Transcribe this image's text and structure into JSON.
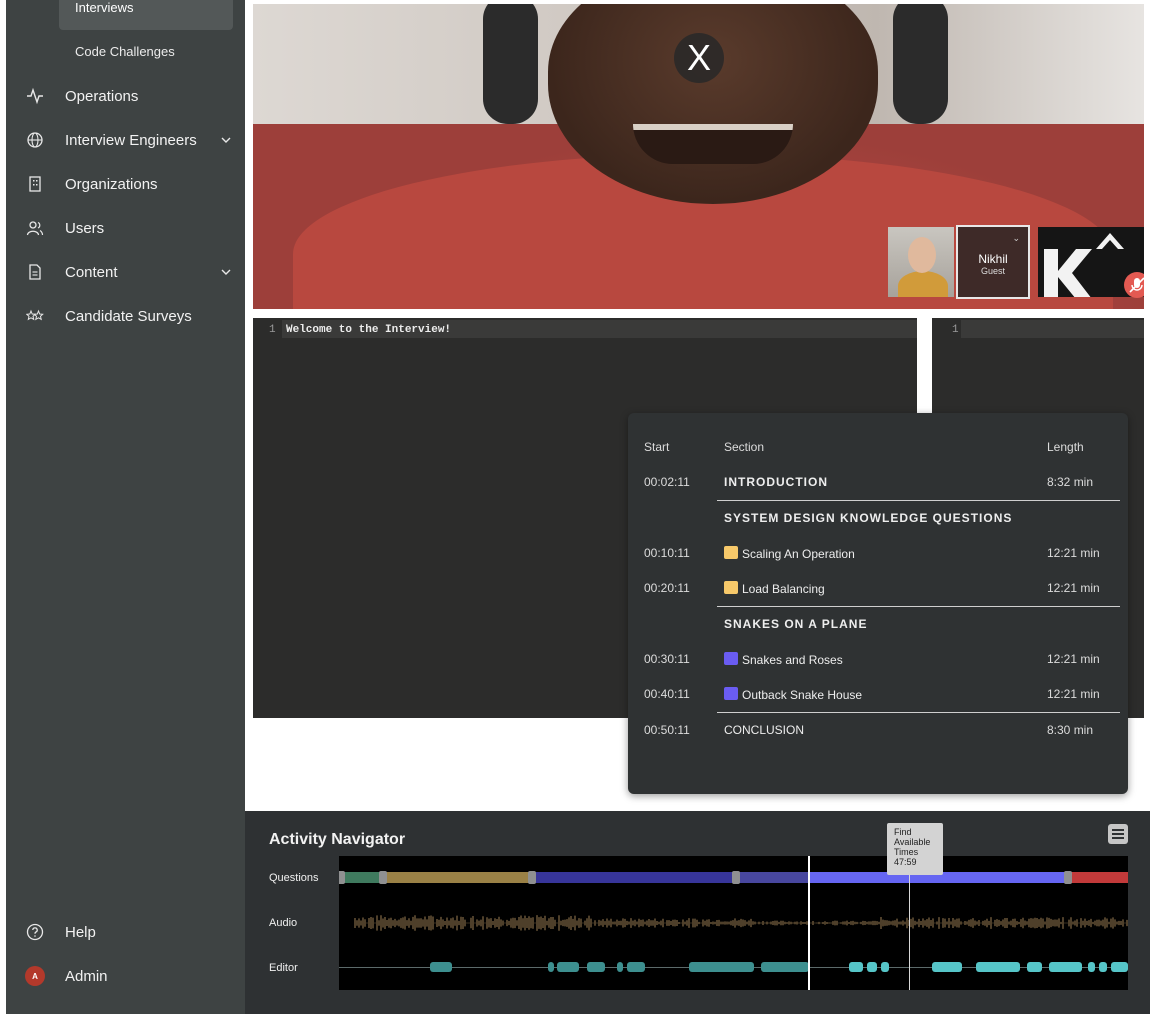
{
  "sidebar": {
    "active_item": "Interviews",
    "sub_item": "Code Challenges",
    "items": [
      {
        "label": "Operations",
        "icon": "activity-icon",
        "chevron": false
      },
      {
        "label": "Interview Engineers",
        "icon": "globe-icon",
        "chevron": true
      },
      {
        "label": "Organizations",
        "icon": "building-icon",
        "chevron": false
      },
      {
        "label": "Users",
        "icon": "users-icon",
        "chevron": false
      },
      {
        "label": "Content",
        "icon": "document-icon",
        "chevron": true
      },
      {
        "label": "Candidate Surveys",
        "icon": "stars-icon",
        "chevron": false
      }
    ],
    "footer": [
      {
        "label": "Help",
        "icon": "help-circle-icon"
      },
      {
        "label": "Admin",
        "icon": "avatar",
        "avatar_letter": "A"
      }
    ]
  },
  "video": {
    "close_glyph": "X",
    "participants": [
      {
        "name": "Nikhil",
        "role": "Guest"
      }
    ]
  },
  "editors": {
    "left": {
      "line_number": "1",
      "code": "Welcome to the Interview!"
    },
    "right": {
      "line_number": "1",
      "code": ""
    }
  },
  "sections_popup": {
    "headers": {
      "start": "Start",
      "section": "Section",
      "length": "Length"
    },
    "rows": [
      {
        "start": "00:02:11",
        "section": "INTRODUCTION",
        "length": "8:32 min",
        "bold": true,
        "swatch": ""
      },
      {
        "start": "",
        "section": "SYSTEM DESIGN KNOWLEDGE QUESTIONS",
        "length": "",
        "bold": true,
        "swatch": ""
      },
      {
        "start": "00:10:11",
        "section": "Scaling An Operation",
        "length": "12:21 min",
        "bold": false,
        "swatch": "#f7c96a"
      },
      {
        "start": "00:20:11",
        "section": "Load Balancing",
        "length": "12:21 min",
        "bold": false,
        "swatch": "#f7c96a"
      },
      {
        "start": "",
        "section": "SNAKES ON A PLANE",
        "length": "",
        "bold": true,
        "swatch": ""
      },
      {
        "start": "00:30:11",
        "section": "Snakes and Roses",
        "length": "12:21 min",
        "bold": false,
        "swatch": "#6a5cf2"
      },
      {
        "start": "00:40:11",
        "section": "Outback Snake House",
        "length": "12:21 min",
        "bold": false,
        "swatch": "#6a5cf2"
      },
      {
        "start": "00:50:11",
        "section": "CONCLUSION",
        "length": "8:30 min",
        "bold": false,
        "swatch": ""
      }
    ]
  },
  "activity_navigator": {
    "title": "Activity Navigator",
    "row_labels": {
      "questions": "Questions",
      "audio": "Audio",
      "editor": "Editor"
    },
    "tooltip": {
      "line1": "Find",
      "line2": "Available",
      "line3": "Times",
      "line4": "47:59"
    },
    "colors": {
      "intro": "#3f7a5e",
      "tan": "#9a8146",
      "indigo": "#37359a",
      "highlight": "#6666f2",
      "conclusion": "#c23a3a",
      "audio": "#9b7e53",
      "editor_dim": "#3d8f8f",
      "editor_bright": "#56c5c8"
    }
  }
}
